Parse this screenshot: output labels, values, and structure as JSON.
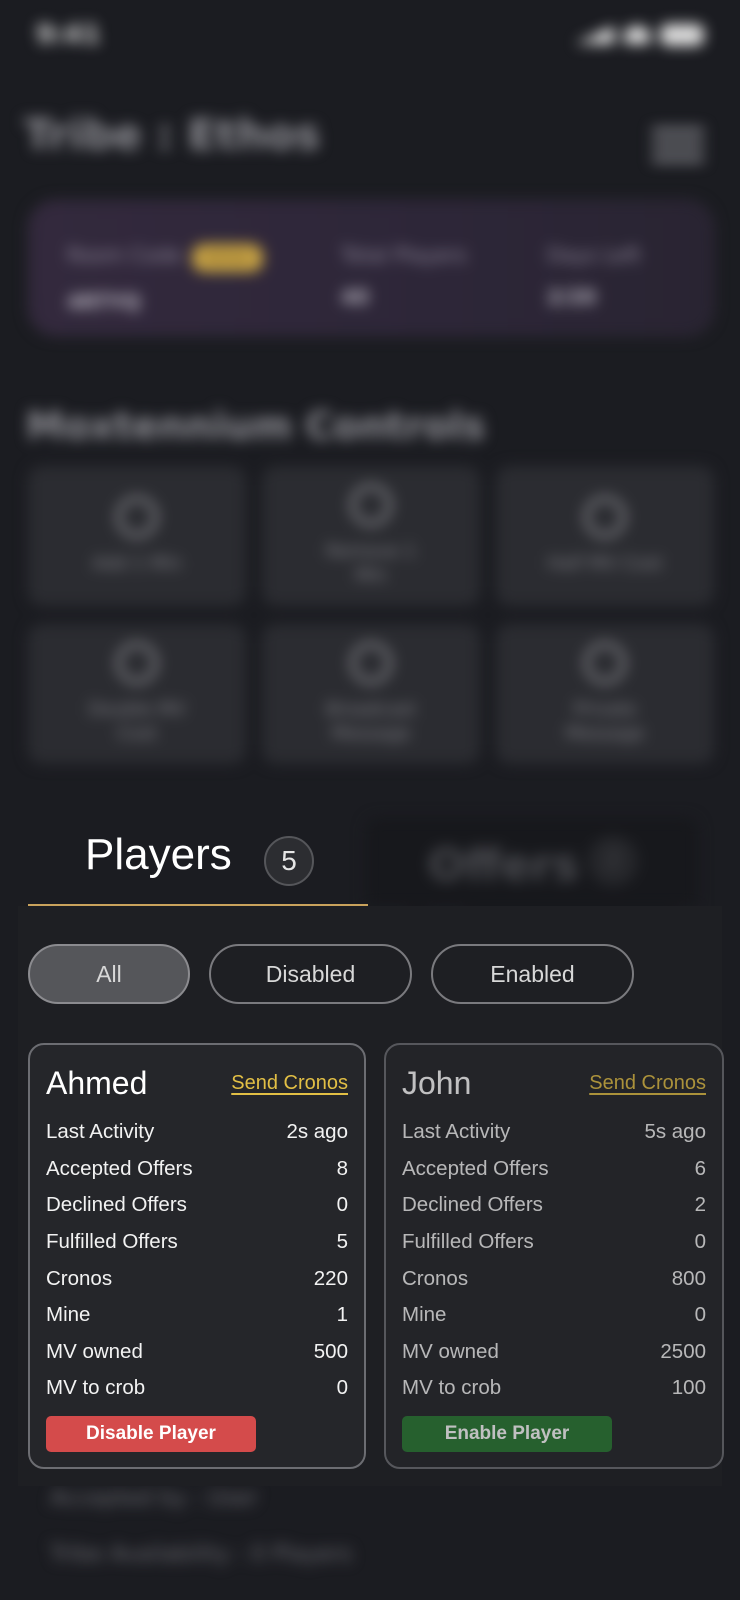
{
  "status_bar": {
    "time": "9:41"
  },
  "header": {
    "title": "Tribe : Ethos"
  },
  "stats": {
    "room_code_label": "Room Code",
    "room_code_badge": "Active",
    "room_code_value": "4RTYQ",
    "total_players_label": "Total Players",
    "total_players_value": "40",
    "days_left_label": "Days Left",
    "days_left_value": "2/20"
  },
  "controls": {
    "title": "Moxtennium Controls",
    "items": [
      {
        "label": "Add 1 Min",
        "icon": "plus-icon"
      },
      {
        "label": "Remove 1 Min",
        "icon": "minus-icon"
      },
      {
        "label": "Half MV Cost",
        "icon": "half-icon"
      },
      {
        "label": "Double MV Cost",
        "icon": "chart-icon"
      },
      {
        "label": "Broadcast Message",
        "icon": "broadcast-icon"
      },
      {
        "label": "Private Message",
        "icon": "message-icon"
      }
    ]
  },
  "tabs": {
    "players": {
      "label": "Players",
      "count": "5"
    },
    "offers": {
      "label": "Offers",
      "count": "2"
    }
  },
  "filters": {
    "all": "All",
    "disabled": "Disabled",
    "enabled": "Enabled",
    "selected": "All"
  },
  "players": [
    {
      "name": "Ahmed",
      "send_label": "Send Cronos",
      "rows": [
        {
          "label": "Last Activity",
          "value": "2s ago"
        },
        {
          "label": "Accepted Offers",
          "value": "8"
        },
        {
          "label": "Declined Offers",
          "value": "0"
        },
        {
          "label": "Fulfilled Offers",
          "value": "5"
        },
        {
          "label": "Cronos",
          "value": "220"
        },
        {
          "label": "Mine",
          "value": "1"
        },
        {
          "label": "MV owned",
          "value": "500"
        },
        {
          "label": "MV to crob",
          "value": "0"
        }
      ],
      "button_label": "Disable Player",
      "button_color": "#d44b4b"
    },
    {
      "name": "John",
      "send_label": "Send Cronos",
      "rows": [
        {
          "label": "Last Activity",
          "value": "5s ago"
        },
        {
          "label": "Accepted Offers",
          "value": "6"
        },
        {
          "label": "Declined Offers",
          "value": "2"
        },
        {
          "label": "Fulfilled Offers",
          "value": "0"
        },
        {
          "label": "Cronos",
          "value": "800"
        },
        {
          "label": "Mine",
          "value": "0"
        },
        {
          "label": "MV owned",
          "value": "2500"
        },
        {
          "label": "MV to crob",
          "value": "100"
        }
      ],
      "button_label": "Enable Player",
      "button_color": "#2a7a33"
    }
  ],
  "background_offer": {
    "accepted_by": "Accepted by : User",
    "tribe_availability": "Tribe Availability : 0 Players"
  },
  "colors": {
    "accent_gold": "#e2bf45",
    "tab_underline": "#c9a25c",
    "background": "#1b1c21"
  }
}
